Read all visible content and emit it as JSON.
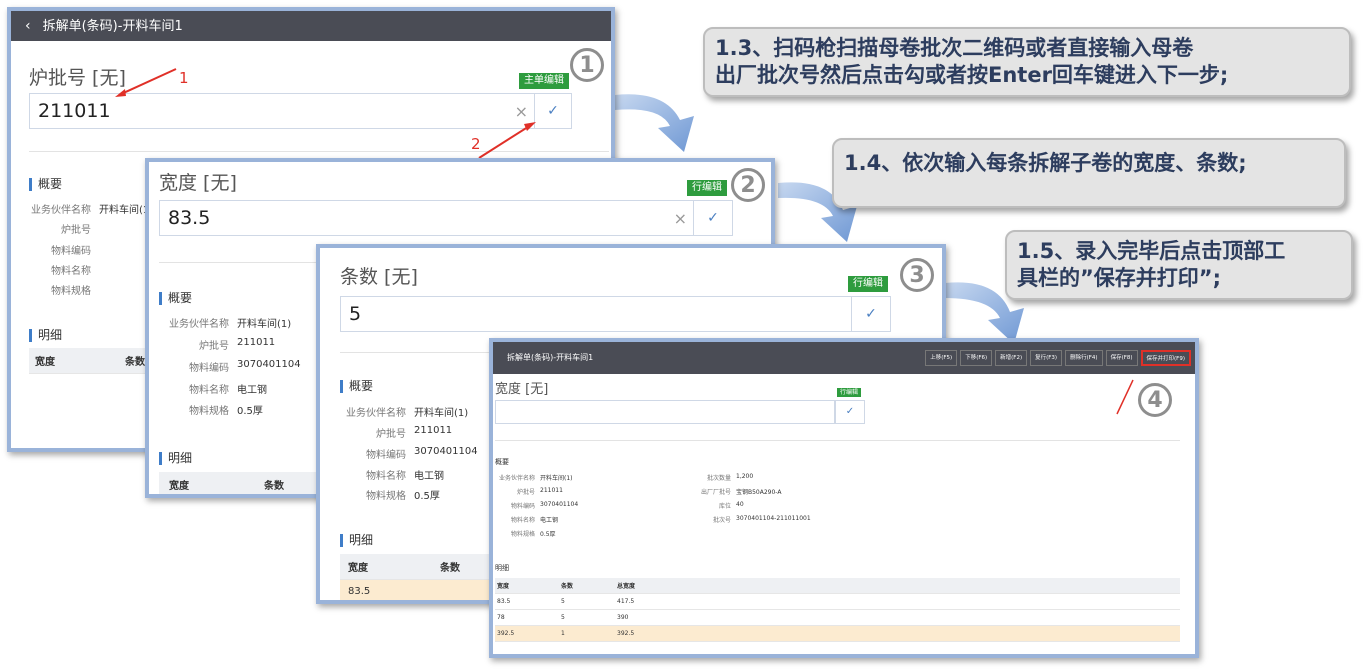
{
  "panel1": {
    "title": "拆解单(条码)-开料车间1",
    "field_label": "炉批号 [无]",
    "tag": "主单编辑",
    "value": "211011",
    "overview_title": "概要",
    "overview": [
      {
        "k": "业务伙伴名称",
        "v": "开料车间(1)"
      },
      {
        "k": "炉批号",
        "v": ""
      },
      {
        "k": "物料编码",
        "v": ""
      },
      {
        "k": "物料名称",
        "v": ""
      },
      {
        "k": "物料规格",
        "v": ""
      }
    ],
    "detail_title": "明细",
    "cols": [
      "宽度",
      "条数"
    ],
    "anno1": "1",
    "anno2": "2"
  },
  "panel2": {
    "field_label": "宽度 [无]",
    "tag": "行编辑",
    "value": "83.5",
    "overview_title": "概要",
    "overview": [
      {
        "k": "业务伙伴名称",
        "v": "开料车间(1)"
      },
      {
        "k": "炉批号",
        "v": "211011"
      },
      {
        "k": "物料编码",
        "v": "3070401104"
      },
      {
        "k": "物料名称",
        "v": "电工钢"
      },
      {
        "k": "物料规格",
        "v": "0.5厚"
      }
    ],
    "detail_title": "明细",
    "cols": [
      "宽度",
      "条数"
    ]
  },
  "panel3": {
    "field_label": "条数 [无]",
    "tag": "行编辑",
    "value": "5",
    "overview_title": "概要",
    "overview": [
      {
        "k": "业务伙伴名称",
        "v": "开料车间(1)"
      },
      {
        "k": "炉批号",
        "v": "211011"
      },
      {
        "k": "物料编码",
        "v": "3070401104"
      },
      {
        "k": "物料名称",
        "v": "电工钢"
      },
      {
        "k": "物料规格",
        "v": "0.5厚"
      }
    ],
    "detail_title": "明细",
    "cols": [
      "宽度",
      "条数"
    ],
    "row_width": "83.5"
  },
  "panel4": {
    "title": "拆解单(条码)-开料车间1",
    "toolbar": [
      "上移(F5)",
      "下移(F6)",
      "新增(F2)",
      "复行(F3)",
      "删除行(F4)",
      "保存(F8)",
      "保存并打印(F9)"
    ],
    "field_label": "宽度 [无]",
    "tag": "行编辑",
    "overview_title": "概要",
    "overview_left": [
      {
        "k": "业务伙伴名称",
        "v": "开料车间(1)"
      },
      {
        "k": "炉批号",
        "v": "211011"
      },
      {
        "k": "物料编码",
        "v": "3070401104"
      },
      {
        "k": "物料名称",
        "v": "电工钢"
      },
      {
        "k": "物料规格",
        "v": "0.5厚"
      }
    ],
    "overview_right": [
      {
        "k": "批次数量",
        "v": "1,200"
      },
      {
        "k": "出厂厂批号",
        "v": "宝钢B50A290-A"
      },
      {
        "k": "库位",
        "v": "40"
      },
      {
        "k": "批次号",
        "v": "3070401104-211011001"
      }
    ],
    "detail_title": "明细",
    "cols": [
      "宽度",
      "条数",
      "总宽度"
    ],
    "rows": [
      [
        "83.5",
        "5",
        "417.5"
      ],
      [
        "78",
        "5",
        "390"
      ],
      [
        "392.5",
        "1",
        "392.5"
      ]
    ]
  },
  "steps": [
    "1",
    "2",
    "3",
    "4"
  ],
  "callouts": {
    "c1": "1.3、扫码枪扫描母卷批次二维码或者直接输入母卷出厂批次号然后点击勾或者按Enter回车键进入下一步;",
    "c1_line1": "1.3、扫码枪扫描母卷批次二维码或者直接输入母卷",
    "c1_line2": "出厂批次号然后点击勾或者按Enter回车键进入下一步;",
    "c2": "1.4、依次输入每条拆解子卷的宽度、条数;",
    "c3_line1": "1.5、录入完毕后点击顶部工",
    "c3_line2": "具栏的”保存并打印”;"
  },
  "colors": {
    "accent": "#3f7dc8",
    "tag": "#2e9c3e",
    "highlight_row": "#fcebd0",
    "annotation": "#e03028",
    "arrow": "#8fb0de"
  }
}
